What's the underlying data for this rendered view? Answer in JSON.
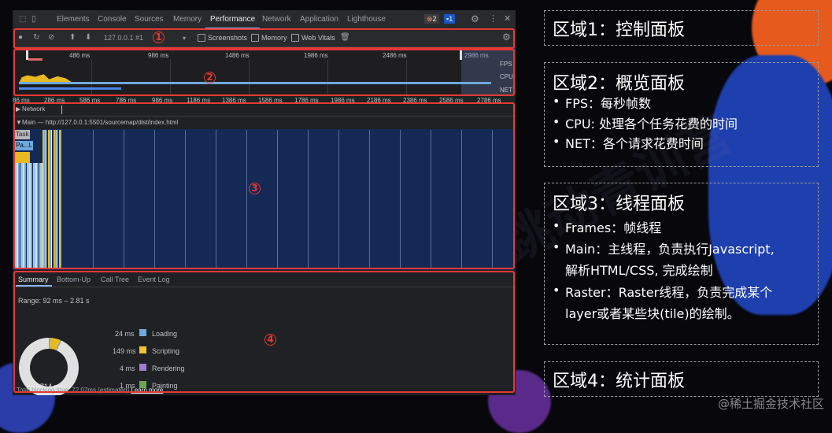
{
  "devtools": {
    "tabs": [
      "Elements",
      "Console",
      "Sources",
      "Memory",
      "Performance",
      "Network",
      "Application",
      "Lighthouse"
    ],
    "active_tab": "Performance",
    "error_count": "2",
    "message_count": "1",
    "toolbar": {
      "profile_select": "127.0.0.1 #1",
      "screenshots_label": "Screenshots",
      "memory_label": "Memory",
      "web_vitals_label": "Web Vitals"
    },
    "overview": {
      "ruler": [
        "486 ms",
        "986 ms",
        "1486 ms",
        "1986 ms",
        "2486 ms",
        "2986 ms"
      ],
      "track_labels": [
        "FPS",
        "CPU",
        "NET"
      ]
    },
    "timeline_ruler": [
      "86 ms",
      "286 ms",
      "586 ms",
      "786 ms",
      "986 ms",
      "1186 ms",
      "1386 ms",
      "1586 ms",
      "1786 ms",
      "1986 ms",
      "2186 ms",
      "2386 ms",
      "2586 ms",
      "2786 ms"
    ],
    "threads": {
      "network_label": "Network",
      "main_label": "Main — http://127.0.0.1:5501/sourcemap/dist/index.html",
      "task_label": "Task",
      "parse_label": "Pa...L"
    },
    "summary": {
      "tabs": [
        "Summary",
        "Bottom-Up",
        "Call Tree",
        "Event Log"
      ],
      "range": "Range: 92 ms – 2.81 s",
      "total": "2714 ms",
      "items": [
        {
          "time": "24 ms",
          "label": "Loading",
          "color": "#6fa8dc"
        },
        {
          "time": "149 ms",
          "label": "Scripting",
          "color": "#f1c232"
        },
        {
          "time": "4 ms",
          "label": "Rendering",
          "color": "#9b7fd4"
        },
        {
          "time": "1 ms",
          "label": "Painting",
          "color": "#6aa84f"
        }
      ],
      "blocking": "Total blocking time: 72.07ms (estimated)",
      "learn_more": "Learn more"
    }
  },
  "markers": [
    "1",
    "2",
    "3",
    "4"
  ],
  "panels": {
    "p1": {
      "title": "区域1：控制面板"
    },
    "p2": {
      "title": "区域2：概览面板",
      "bullets": [
        "FPS：每秒帧数",
        "CPU: 处理各个任务花费的时间",
        "NET：各个请求花费时间"
      ]
    },
    "p3": {
      "title": "区域3：线程面板",
      "bullets": [
        "Frames：帧线程",
        "Main：主线程，负责执行Javascript,",
        "解析HTML/CSS, 完成绘制",
        "Raster：Raster线程，负责完成某个",
        "layer或者某些块(tile)的绘制。"
      ]
    },
    "p4": {
      "title": "区域4：统计面板"
    }
  },
  "watermark": "字节跳动青训营",
  "footer": "@稀土掘金技术社区",
  "colors": {
    "accent_red": "#e53935",
    "background": "#07070c",
    "flame_blue": "#142a55"
  }
}
